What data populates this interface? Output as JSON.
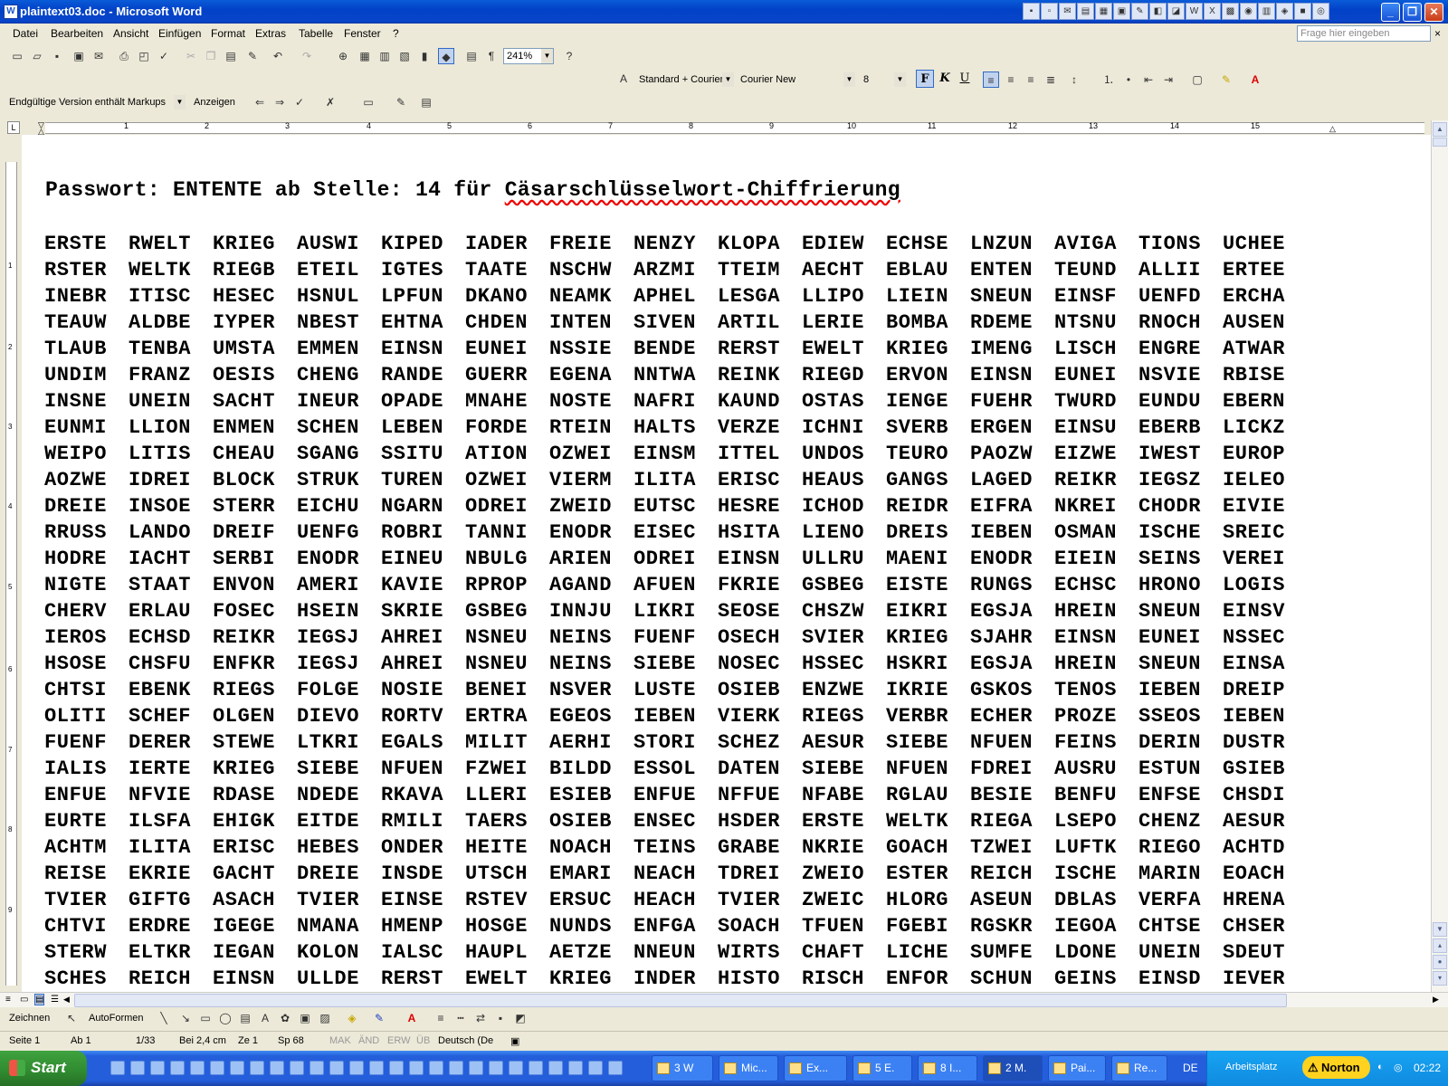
{
  "window": {
    "title": "plaintext03.doc - Microsoft Word",
    "minimize": "_",
    "maximize": "❐",
    "close": "✕"
  },
  "menu": {
    "items": [
      "Datei",
      "Bearbeiten",
      "Ansicht",
      "Einfügen",
      "Format",
      "Extras",
      "Tabelle",
      "Fenster",
      "?"
    ],
    "help_placeholder": "Frage hier eingeben",
    "help_close": "×"
  },
  "standard_toolbar": {
    "zoom": "241%"
  },
  "formatting_toolbar": {
    "style": "Standard + Courier",
    "font": "Courier New",
    "size": "8",
    "bold": "F",
    "italic": "K",
    "underline": "U"
  },
  "review_toolbar": {
    "markup_mode": "Endgültige Version enthält Markups",
    "show_label": "Anzeigen"
  },
  "ruler": {
    "numbers": [
      "1",
      "2",
      "3",
      "4",
      "5",
      "6",
      "7",
      "8",
      "9",
      "10",
      "11",
      "12",
      "13",
      "14",
      "15"
    ],
    "vertical_numbers": [
      "1",
      "2",
      "3",
      "4",
      "5",
      "6",
      "7",
      "8",
      "9"
    ]
  },
  "document": {
    "heading_pre": "Passwort: ENTENTE ab Stelle: 14 für ",
    "heading_spell": "Cäsarschlüsselwort-Chiffrierung",
    "cipher_rows": [
      [
        "ERSTE",
        "RWELT",
        "KRIEG",
        "AUSWI",
        "KIPED",
        "IADER",
        "FREIE",
        "NENZY",
        "KLOPA",
        "EDIEW",
        "ECHSE",
        "LNZUN",
        "AVIGA",
        "TIONS",
        "UCHEE"
      ],
      [
        "RSTER",
        "WELTK",
        "RIEGB",
        "ETEIL",
        "IGTES",
        "TAATE",
        "NSCHW",
        "ARZMI",
        "TTEIM",
        "AECHT",
        "EBLAU",
        "ENTEN",
        "TEUND",
        "ALLII",
        "ERTEE"
      ],
      [
        "INEBR",
        "ITISC",
        "HESEC",
        "HSNUL",
        "LPFUN",
        "DKANO",
        "NEAMK",
        "APHEL",
        "LESGA",
        "LLIPO",
        "LIEIN",
        "SNEUN",
        "EINSF",
        "UENFD",
        "ERCHA"
      ],
      [
        "TEAUW",
        "ALDBE",
        "IYPER",
        "NBEST",
        "EHTNA",
        "CHDEN",
        "INTEN",
        "SIVEN",
        "ARTIL",
        "LERIE",
        "BOMBA",
        "RDEME",
        "NTSNU",
        "RNOCH",
        "AUSEN"
      ],
      [
        "TLAUB",
        "TENBA",
        "UMSTA",
        "EMMEN",
        "EINSN",
        "EUNEI",
        "NSSIE",
        "BENDE",
        "RERST",
        "EWELT",
        "KRIEG",
        "IMENG",
        "LISCH",
        "ENGRE",
        "ATWAR"
      ],
      [
        "UNDIM",
        "FRANZ",
        "OESIS",
        "CHENG",
        "RANDE",
        "GUERR",
        "EGENA",
        "NNTWA",
        "REINK",
        "RIEGD",
        "ERVON",
        "EINSN",
        "EUNEI",
        "NSVIE",
        "RBISE"
      ],
      [
        "INSNE",
        "UNEIN",
        "SACHT",
        "INEUR",
        "OPADE",
        "MNAHE",
        "NOSTE",
        "NAFRI",
        "KAUND",
        "OSTAS",
        "IENGE",
        "FUEHR",
        "TWURD",
        "EUNDU",
        "EBERN"
      ],
      [
        "EUNMI",
        "LLION",
        "ENMEN",
        "SCHEN",
        "LEBEN",
        "FORDE",
        "RTEIN",
        "HALTS",
        "VERZE",
        "ICHNI",
        "SVERB",
        "ERGEN",
        "EINSU",
        "EBERB",
        "LICKZ"
      ],
      [
        "WEIPO",
        "LITIS",
        "CHEAU",
        "SGANG",
        "SSITU",
        "ATION",
        "OZWEI",
        "EINSM",
        "ITTEL",
        "UNDOS",
        "TEURO",
        "PAOZW",
        "EIZWE",
        "IWEST",
        "EUROP"
      ],
      [
        "AOZWE",
        "IDREI",
        "BLOCK",
        "STRUK",
        "TUREN",
        "OZWEI",
        "VIERM",
        "ILITA",
        "ERISC",
        "HEAUS",
        "GANGS",
        "LAGED",
        "REIKR",
        "IEGSZ",
        "IELEO"
      ],
      [
        "DREIE",
        "INSOE",
        "STERR",
        "EICHU",
        "NGARN",
        "ODREI",
        "ZWEID",
        "EUTSC",
        "HESRE",
        "ICHOD",
        "REIDR",
        "EIFRA",
        "NKREI",
        "CHODR",
        "EIVIE"
      ],
      [
        "RRUSS",
        "LANDO",
        "DREIF",
        "UENFG",
        "ROBRI",
        "TANNI",
        "ENODR",
        "EISEC",
        "HSITA",
        "LIENO",
        "DREIS",
        "IEBEN",
        "OSMAN",
        "ISCHE",
        "SREIC"
      ],
      [
        "HODRE",
        "IACHT",
        "SERBI",
        "ENODR",
        "EINEU",
        "NBULG",
        "ARIEN",
        "ODREI",
        "EINSN",
        "ULLRU",
        "MAENI",
        "ENODR",
        "EIEIN",
        "SEINS",
        "VEREI"
      ],
      [
        "NIGTE",
        "STAAT",
        "ENVON",
        "AMERI",
        "KAVIE",
        "RPROP",
        "AGAND",
        "AFUEN",
        "FKRIE",
        "GSBEG",
        "EISTE",
        "RUNGS",
        "ECHSC",
        "HRONO",
        "LOGIS"
      ],
      [
        "CHERV",
        "ERLAU",
        "FOSEC",
        "HSEIN",
        "SKRIE",
        "GSBEG",
        "INNJU",
        "LIKRI",
        "SEOSE",
        "CHSZW",
        "EIKRI",
        "EGSJA",
        "HREIN",
        "SNEUN",
        "EINSV"
      ],
      [
        "IEROS",
        "ECHSD",
        "REIKR",
        "IEGSJ",
        "AHREI",
        "NSNEU",
        "NEINS",
        "FUENF",
        "OSECH",
        "SVIER",
        "KRIEG",
        "SJAHR",
        "EINSN",
        "EUNEI",
        "NSSEC"
      ],
      [
        "HSOSE",
        "CHSFU",
        "ENFKR",
        "IEGSJ",
        "AHREI",
        "NSNEU",
        "NEINS",
        "SIEBE",
        "NOSEC",
        "HSSEC",
        "HSKRI",
        "EGSJA",
        "HREIN",
        "SNEUN",
        "EINSA"
      ],
      [
        "CHTSI",
        "EBENK",
        "RIEGS",
        "FOLGE",
        "NOSIE",
        "BENEI",
        "NSVER",
        "LUSTE",
        "OSIEB",
        "ENZWE",
        "IKRIE",
        "GSKOS",
        "TENOS",
        "IEBEN",
        "DREIP"
      ],
      [
        "OLITI",
        "SCHEF",
        "OLGEN",
        "DIEVO",
        "RORTV",
        "ERTRA",
        "EGEOS",
        "IEBEN",
        "VIERK",
        "RIEGS",
        "VERBR",
        "ECHER",
        "PROZE",
        "SSEOS",
        "IEBEN"
      ],
      [
        "FUENF",
        "DERER",
        "STEWE",
        "LTKRI",
        "EGALS",
        "MILIT",
        "AERHI",
        "STORI",
        "SCHEZ",
        "AESUR",
        "SIEBE",
        "NFUEN",
        "FEINS",
        "DERIN",
        "DUSTR"
      ],
      [
        "IALIS",
        "IERTE",
        "KRIEG",
        "SIEBE",
        "NFUEN",
        "FZWEI",
        "BILDD",
        "ESSOL",
        "DATEN",
        "SIEBE",
        "NFUEN",
        "FDREI",
        "AUSRU",
        "ESTUN",
        "GSIEB"
      ],
      [
        "ENFUE",
        "NFVIE",
        "RDASE",
        "NDEDE",
        "RKAVA",
        "LLERI",
        "ESIEB",
        "ENFUE",
        "NFFUE",
        "NFABE",
        "RGLAU",
        "BESIE",
        "BENFU",
        "ENFSE",
        "CHSDI"
      ],
      [
        "EURTE",
        "ILSFA",
        "EHIGK",
        "EITDE",
        "RMILI",
        "TAERS",
        "OSIEB",
        "ENSEC",
        "HSDER",
        "ERSTE",
        "WELTK",
        "RIEGA",
        "LSEPO",
        "CHENZ",
        "AESUR"
      ],
      [
        "ACHTM",
        "ILITA",
        "ERISC",
        "HEBES",
        "ONDER",
        "HEITE",
        "NOACH",
        "TEINS",
        "GRABE",
        "NKRIE",
        "GOACH",
        "TZWEI",
        "LUFTK",
        "RIEGO",
        "ACHTD"
      ],
      [
        "REISE",
        "EKRIE",
        "GACHT",
        "DREIE",
        "INSDE",
        "UTSCH",
        "EMARI",
        "NEACH",
        "TDREI",
        "ZWEIO",
        "ESTER",
        "REICH",
        "ISCHE",
        "MARIN",
        "EOACH"
      ],
      [
        "TVIER",
        "GIFTG",
        "ASACH",
        "TVIER",
        "EINSE",
        "RSTEV",
        "ERSUC",
        "HEACH",
        "TVIER",
        "ZWEIC",
        "HLORG",
        "ASEUN",
        "DBLAS",
        "VERFA",
        "HRENA"
      ],
      [
        "CHTVI",
        "ERDRE",
        "IGEGE",
        "NMANA",
        "HMENP",
        "HOSGE",
        "NUNDS",
        "ENFGA",
        "SOACH",
        "TFUEN",
        "FGEBI",
        "RGSKR",
        "IEGOA",
        "CHTSE",
        "CHSER"
      ],
      [
        "STERW",
        "ELTKR",
        "IEGAN",
        "KOLON",
        "IALSC",
        "HAUPL",
        "AETZE",
        "NNEUN",
        "WIRTS",
        "CHAFT",
        "LICHE",
        "SUMFE",
        "LDONE",
        "UNEIN",
        "SDEUT"
      ],
      [
        "SCHES",
        "REICH",
        "EINSN",
        "ULLDE",
        "RERST",
        "EWELT",
        "KRIEG",
        "INDER",
        "HISTO",
        "RISCH",
        "ENFOR",
        "SCHUN",
        "GEINS",
        "EINSD",
        "IEVER"
      ]
    ]
  },
  "drawing_toolbar": {
    "draw_label": "Zeichnen",
    "autoshapes_label": "AutoFormen"
  },
  "status": {
    "page": "Seite  1",
    "section": "Ab  1",
    "pages": "1/33",
    "position": "Bei  2,4 cm",
    "line": "Ze  1",
    "column": "Sp  68",
    "mak": "MAK",
    "aend": "ÄND",
    "erw": "ERW",
    "ueb": "ÜB",
    "language": "Deutsch (De"
  },
  "taskbar": {
    "start": "Start",
    "tasks": [
      "3 W",
      "Mic...",
      "Ex...",
      "5 E.",
      "8 I...",
      "2 M.",
      "Pai...",
      "Re..."
    ],
    "lang": "DE",
    "workspace": "Arbeitsplatz",
    "norton": "Norton",
    "clock": "02:22"
  }
}
